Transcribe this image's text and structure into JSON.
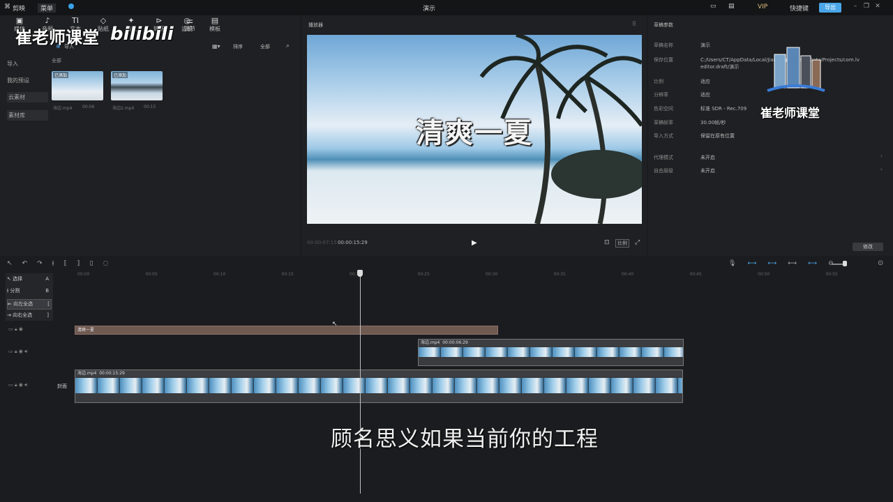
{
  "titlebar": {
    "app_name": "剪映",
    "menu": "菜单",
    "doc_title": "演示",
    "vip": "VIP",
    "shortcut": "快捷键",
    "export": "导出"
  },
  "watermark": {
    "left_text": "崔老师课堂",
    "bili_text": "bilibili",
    "right_text": "崔老师课堂"
  },
  "media_toolbar": {
    "items": [
      {
        "label": "媒体",
        "glyph": "▣"
      },
      {
        "label": "音频",
        "glyph": "♪"
      },
      {
        "label": "文本",
        "glyph": "TI"
      },
      {
        "label": "贴纸",
        "glyph": "◇"
      },
      {
        "label": "特效",
        "glyph": "✦"
      },
      {
        "label": "转场",
        "glyph": "⊳"
      },
      {
        "label": "滤镜",
        "glyph": "◎"
      },
      {
        "label": "调节",
        "glyph": "⚌"
      },
      {
        "label": "模板",
        "glyph": "▤"
      }
    ]
  },
  "media": {
    "import_label": "导入",
    "sort_label": "排序",
    "all_label": "全部",
    "section_label": "全部",
    "sidebar": [
      "导入",
      "我的预设",
      "云素材",
      "素材库"
    ],
    "thumbs": [
      {
        "tag": "已添加",
        "name": "海边.mp4",
        "duration": "00:06"
      },
      {
        "tag": "已添加",
        "name": "海边2.mp4",
        "duration": "00:15"
      }
    ]
  },
  "player": {
    "label": "播放器",
    "preview_title": "清爽一夏",
    "time_current": "00:00:07:15",
    "time_total": "00:00:15:29",
    "ratio_label": "比例"
  },
  "params": {
    "label": "草稿参数",
    "rows": [
      {
        "label": "草稿名称",
        "value": "演示"
      },
      {
        "label": "保存位置",
        "value": "C:/Users/CT/AppData/Local/JianyingPro/User Data/Projects/com.lveditor.draft/演示"
      },
      {
        "label": "比例",
        "value": "适应"
      },
      {
        "label": "分辨率",
        "value": "适应"
      },
      {
        "label": "色彩空间",
        "value": "标准 SDR - Rec.709"
      },
      {
        "label": "草稿帧率",
        "value": "30.00帧/秒"
      },
      {
        "label": "导入方式",
        "value": "保留在原有位置"
      },
      {
        "label": "代理模式",
        "value": "未开启"
      },
      {
        "label": "自由层级",
        "value": "未开启"
      }
    ],
    "edit_button": "修改"
  },
  "timeline": {
    "ruler": [
      "00:00",
      "00:05",
      "00:10",
      "00:15",
      "00:20",
      "00:25",
      "00:30",
      "00:35",
      "00:40",
      "00:45",
      "00:50",
      "00:55"
    ],
    "mode_menu": [
      {
        "label": "选择",
        "key": "A"
      },
      {
        "label": "分割",
        "key": "B"
      },
      {
        "label": "向左全选",
        "key": "["
      },
      {
        "label": "向右全选",
        "key": "]"
      }
    ],
    "text_clip": {
      "label": "清爽一夏"
    },
    "overlay_clip": {
      "name": "海边.mp4",
      "duration": "00:00:06:29"
    },
    "main_clip": {
      "name": "海边.mp4",
      "duration": "00:00:15:29"
    },
    "cover_label": "封面"
  },
  "subtitle": "顾名思义如果当前你的工程"
}
